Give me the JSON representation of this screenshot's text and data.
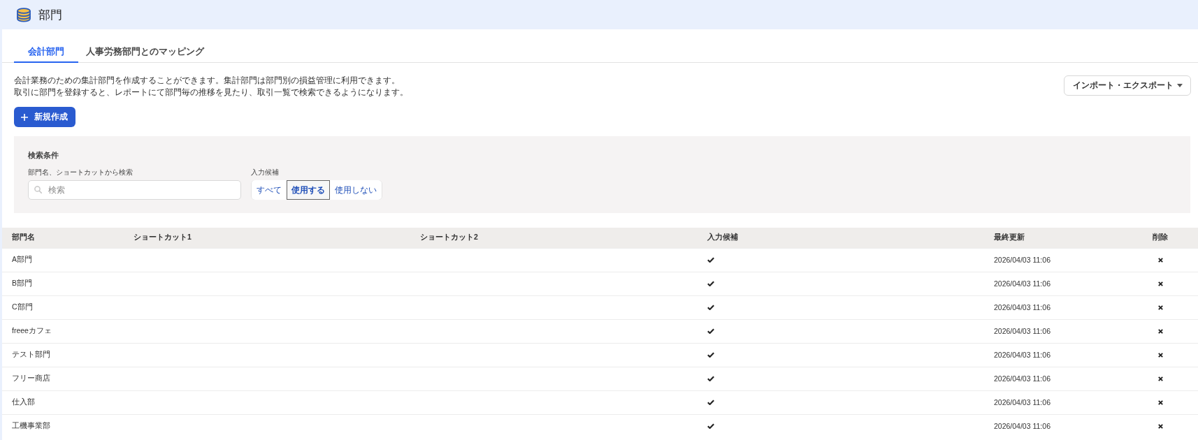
{
  "header": {
    "title": "部門"
  },
  "tabs": [
    {
      "label": "会計部門",
      "selected": true
    },
    {
      "label": "人事労務部門とのマッピング",
      "selected": false
    }
  ],
  "description": [
    "会計業務のための集計部門を作成することができます。集計部門は部門別の損益管理に利用できます。",
    "取引に部門を登録すると、レポートにて部門毎の推移を見たり、取引一覧で検索できるようになります。"
  ],
  "import_export_button": {
    "label": "インポート・エクスポート"
  },
  "new_button": {
    "label": "新規作成"
  },
  "search_panel": {
    "title": "検索条件",
    "keyword_field": {
      "label": "部門名、ショートカットから検索",
      "placeholder": "検索"
    },
    "candidate_filter": {
      "label": "入力候補",
      "options": [
        {
          "label": "すべて",
          "selected": false
        },
        {
          "label": "使用する",
          "selected": true
        },
        {
          "label": "使用しない",
          "selected": false
        }
      ]
    }
  },
  "table": {
    "columns": [
      "部門名",
      "ショートカット1",
      "ショートカット2",
      "入力候補",
      "最終更新",
      "削除"
    ],
    "rows": [
      {
        "name": "A部門",
        "input_candidate": true,
        "updated": "2026/04/03 11:06"
      },
      {
        "name": "B部門",
        "input_candidate": true,
        "updated": "2026/04/03 11:06"
      },
      {
        "name": "C部門",
        "input_candidate": true,
        "updated": "2026/04/03 11:06"
      },
      {
        "name": "freeeカフェ",
        "input_candidate": true,
        "updated": "2026/04/03 11:06"
      },
      {
        "name": "テスト部門",
        "input_candidate": true,
        "updated": "2026/04/03 11:06"
      },
      {
        "name": "フリー商店",
        "input_candidate": true,
        "updated": "2026/04/03 11:06"
      },
      {
        "name": "仕入部",
        "input_candidate": true,
        "updated": "2026/04/03 11:06"
      },
      {
        "name": "工機事業部",
        "input_candidate": true,
        "updated": "2026/04/03 11:06"
      }
    ]
  }
}
